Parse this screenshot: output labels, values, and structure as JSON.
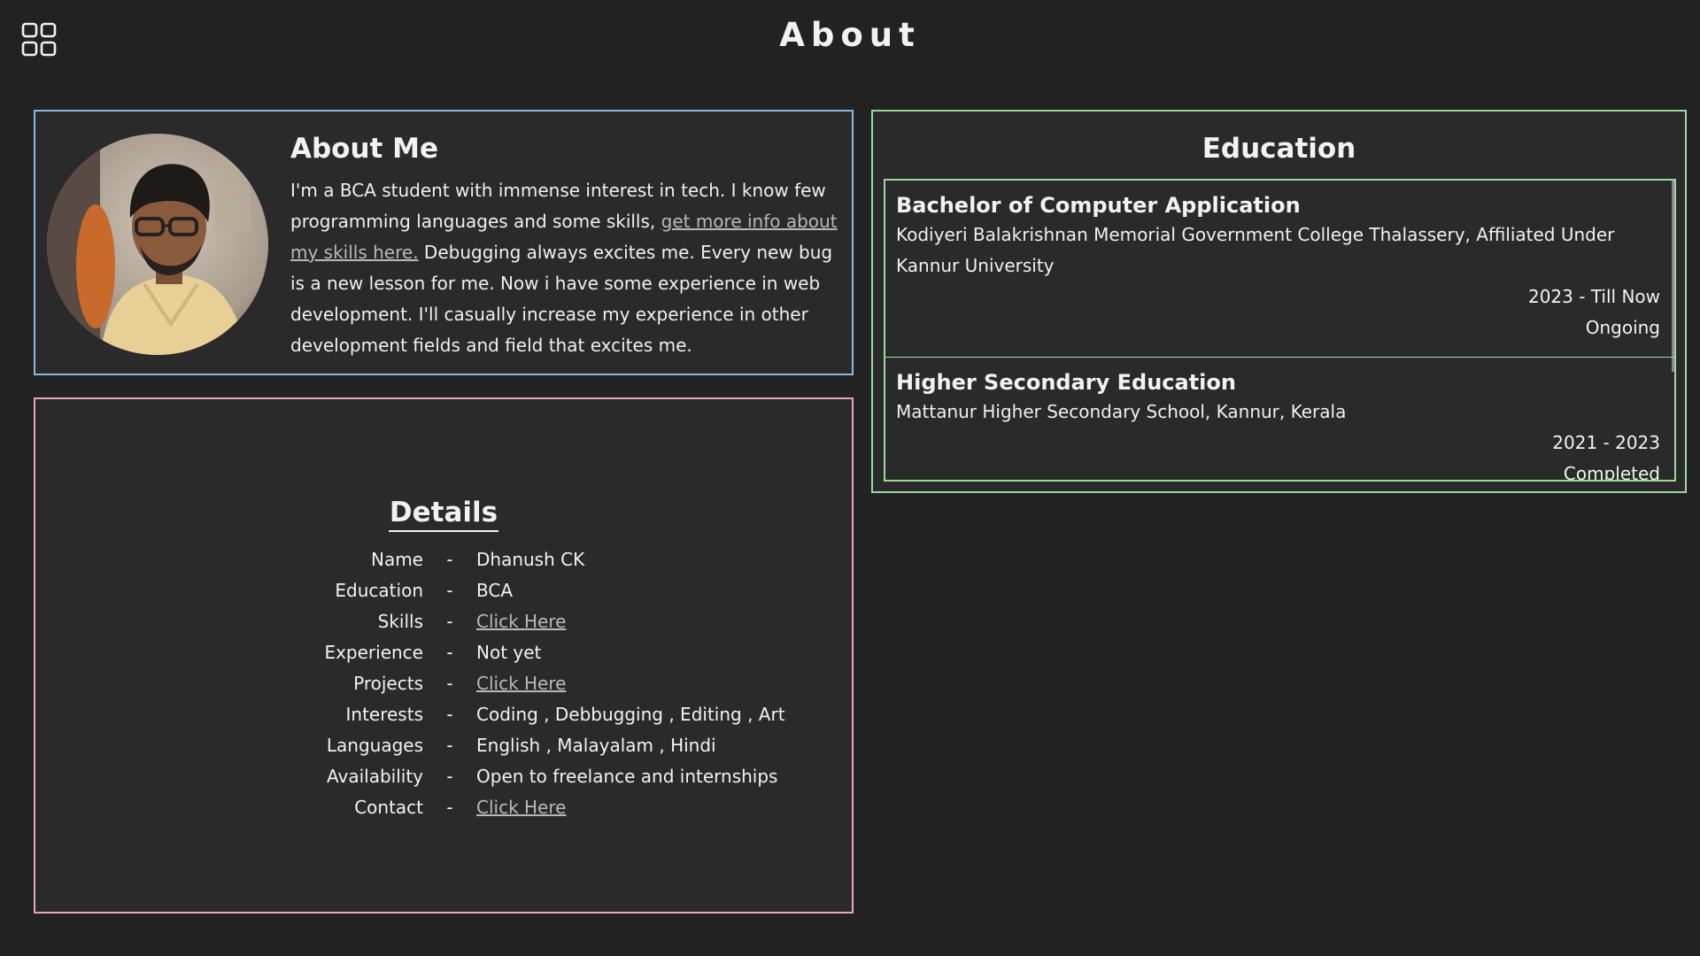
{
  "header": {
    "title": "About",
    "menu_icon": "grid-icon"
  },
  "about": {
    "title": "About Me",
    "avatar_icon": "profile-photo",
    "text_before_link": "I'm a BCA student with immense interest in tech. I know few programming languages and some skills, ",
    "link_text": "get more info about my skills here.",
    "text_after_link": " Debugging always excites me. Every new bug is a new lesson for me. Now i have some experience in web development. I'll casually increase my experience in other development fields and field that excites me."
  },
  "details": {
    "title": "Details",
    "separator": "-",
    "rows": [
      {
        "label": "Name",
        "value": "Dhanush CK",
        "link": false
      },
      {
        "label": "Education",
        "value": "BCA",
        "link": false
      },
      {
        "label": "Skills",
        "value": "Click Here",
        "link": true
      },
      {
        "label": "Experience",
        "value": "Not yet",
        "link": false
      },
      {
        "label": "Projects",
        "value": "Click Here",
        "link": true
      },
      {
        "label": "Interests",
        "value": "Coding , Debbugging , Editing , Art",
        "link": false
      },
      {
        "label": "Languages",
        "value": "English , Malayalam , Hindi",
        "link": false
      },
      {
        "label": "Availability",
        "value": "Open to freelance and internships",
        "link": false
      },
      {
        "label": "Contact",
        "value": "Click Here",
        "link": true
      }
    ]
  },
  "education": {
    "title": "Education",
    "items": [
      {
        "degree": "Bachelor of Computer Application",
        "school": "Kodiyeri Balakrishnan Memorial Government College Thalassery, Affiliated Under Kannur University",
        "years": "2023 - Till Now",
        "status": "Ongoing"
      },
      {
        "degree": "Higher Secondary Education",
        "school": "Mattanur Higher Secondary School, Kannur, Kerala",
        "years": "2021 - 2023",
        "status": "Completed"
      }
    ]
  },
  "colors": {
    "background": "#222222",
    "card": "#2a2a2a",
    "about_border": "#8ab9e0",
    "details_border": "#e6a6c3",
    "education_border": "#9ad99a",
    "link": "#b9b9b9"
  }
}
